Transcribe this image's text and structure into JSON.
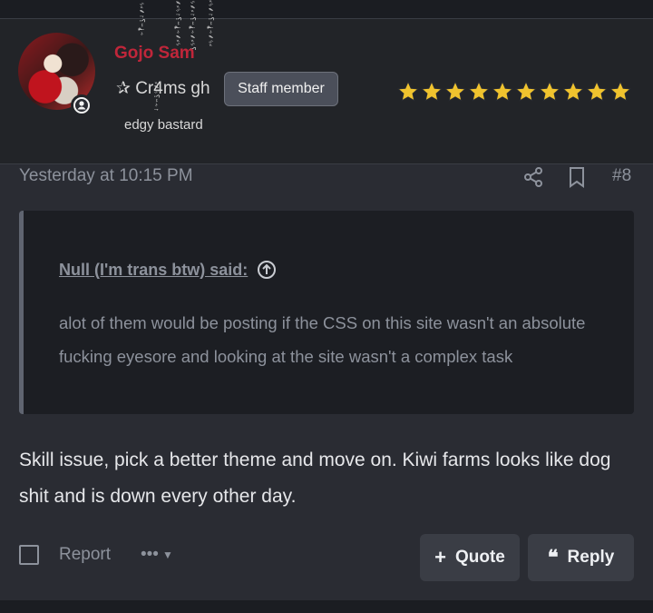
{
  "user": {
    "name": "Gojo Sam",
    "title": "✰ Cr4ms gh",
    "subtitle": "edgy bastard",
    "badge": "Staff member",
    "star_count": 10,
    "star_color": "#f0c32e",
    "name_color": "#c0263a"
  },
  "post": {
    "timestamp": "Yesterday at 10:15 PM",
    "number": "#8",
    "quote": {
      "author": "Null (I'm trans btw) said:",
      "text": "alot of them would be posting if the CSS on this site wasn't an absolute fucking eyesore and looking at the site wasn't a complex task"
    },
    "body": "Skill issue, pick a better theme and move on. Kiwi farms looks like dog shit and is down every other day."
  },
  "actions": {
    "report": "Report",
    "more": "•••",
    "quote": "Quote",
    "reply": "Reply"
  },
  "icons": {
    "share": "share-icon",
    "bookmark": "bookmark-icon",
    "jump_to_quote": "arrow-up-circle-icon",
    "status": "user-status-icon"
  }
}
